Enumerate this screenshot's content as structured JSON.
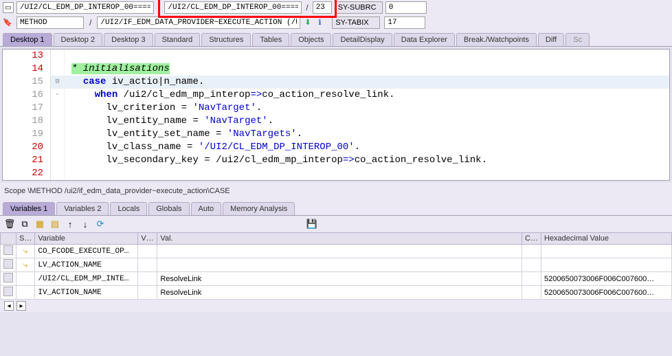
{
  "top": {
    "addr1": "/UI2/CL_EDM_DP_INTEROP_00====…",
    "addr2": "/UI2/CL_EDM_DP_INTEROP_00====…",
    "lineno": "23",
    "subrc_label": "SY-SUBRC",
    "subrc_val": "0"
  },
  "row2": {
    "method": "METHOD",
    "path": "/UI2/IF_EDM_DATA_PROVIDER~EXECUTE_ACTION (/U…",
    "tabix_label": "SY-TABIX",
    "tabix_val": "17"
  },
  "tabs": [
    "Desktop 1",
    "Desktop 2",
    "Desktop 3",
    "Standard",
    "Structures",
    "Tables",
    "Objects",
    "DetailDisplay",
    "Data Explorer",
    "Break./Watchpoints",
    "Diff",
    "Sc"
  ],
  "code_lines": [
    {
      "n": "13",
      "red": true,
      "fold": "",
      "html": ""
    },
    {
      "n": "14",
      "red": true,
      "fold": "",
      "html": "<span class='cmt-bg'>* initialisations</span>"
    },
    {
      "n": "15",
      "red": false,
      "fold": "⊟",
      "hl": true,
      "html": "  <span class='kw'>case</span> <span class='id'>iv_actio</span>|<span class='id'>n_name</span>."
    },
    {
      "n": "16",
      "red": false,
      "fold": "◦",
      "html": "    <span class='kw'>when</span> <span class='cls'>/ui2/cl_edm_mp_interop</span><span class='op'>=&gt;</span><span class='id'>co_action_resolve_link</span>."
    },
    {
      "n": "17",
      "red": false,
      "fold": "",
      "html": "      <span class='id'>lv_criterion</span> = <span class='str'>'NavTarget'</span>."
    },
    {
      "n": "18",
      "red": false,
      "fold": "",
      "html": "      <span class='id'>lv_entity_name</span> = <span class='str'>'NavTarget'</span>."
    },
    {
      "n": "19",
      "red": false,
      "fold": "",
      "html": "      <span class='id'>lv_entity_set_name</span> = <span class='str'>'NavTargets'</span>."
    },
    {
      "n": "20",
      "red": true,
      "fold": "",
      "html": "      <span class='id'>lv_class_name</span> = <span class='str'>'/UI2/CL_EDM_DP_INTEROP_00'</span>."
    },
    {
      "n": "21",
      "red": true,
      "fold": "",
      "html": "      <span class='id'>lv_secondary_key</span> = <span class='cls'>/ui2/cl_edm_mp_interop</span><span class='op'>=&gt;</span><span class='id'>co_action_resolve_link</span>."
    },
    {
      "n": "22",
      "red": true,
      "fold": "",
      "html": ""
    }
  ],
  "scope": "Scope \\METHOD /ui2/if_edm_data_provider~execute_action\\CASE",
  "vtabs": [
    "Variables 1",
    "Variables 2",
    "Locals",
    "Globals",
    "Auto",
    "Memory Analysis"
  ],
  "var_headers": {
    "st": "S…",
    "var": "Variable",
    "vt": "V…",
    "val": "Val.",
    "c": "C…",
    "hex": "Hexadecimal Value"
  },
  "var_rows": [
    {
      "st": "arrow",
      "name": "CO_FCODE_EXECUTE_OP…",
      "white": true,
      "val": "",
      "hex": ""
    },
    {
      "st": "arrow",
      "name": "LV_ACTION_NAME",
      "white": true,
      "val": "",
      "hex": ""
    },
    {
      "st": "",
      "name": "/UI2/CL_EDM_MP_INTE…",
      "white": false,
      "val": "ResolveLink",
      "hex": "5200650073006F006C007600…"
    },
    {
      "st": "",
      "name": "IV_ACTION_NAME",
      "white": false,
      "val": "ResolveLink",
      "hex": "5200650073006F006C007600…"
    }
  ]
}
